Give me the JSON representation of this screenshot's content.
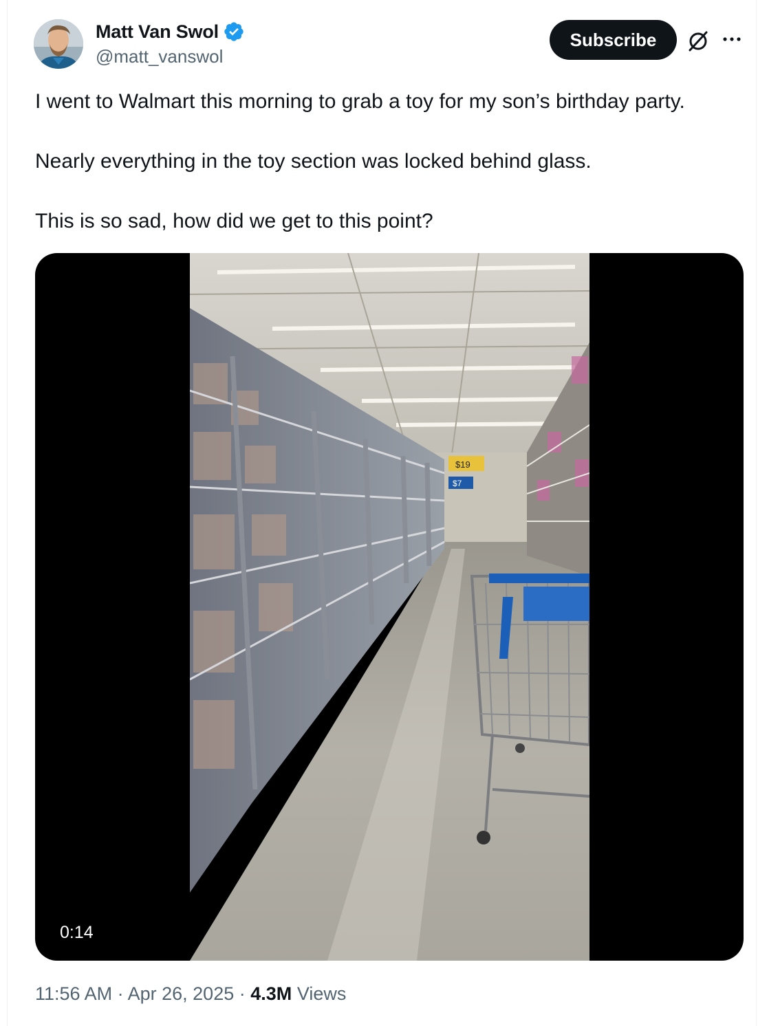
{
  "author": {
    "display_name": "Matt Van Swol",
    "handle": "@matt_vanswol",
    "verified": true,
    "avatar_icon": "profile-photo"
  },
  "actions": {
    "subscribe_label": "Subscribe",
    "grok_icon": "grok-icon",
    "more_icon": "more-icon"
  },
  "tweet": {
    "paragraphs": [
      "I went to Walmart this morning to grab a toy for my son’s birthday party.",
      "Nearly everything in the toy section was locked behind glass.",
      "This is so sad, how did we get to this point?"
    ]
  },
  "media": {
    "type": "video",
    "duration": "0:14",
    "visible_price_tags": [
      "$19",
      "$7"
    ]
  },
  "meta": {
    "time": "11:56 AM",
    "separator": "·",
    "date": "Apr 26, 2025",
    "views_count": "4.3M",
    "views_label": "Views"
  },
  "colors": {
    "text_primary": "#0f1419",
    "text_secondary": "#536471",
    "verified_blue": "#1d9bf0",
    "button_bg": "#0f1419"
  }
}
